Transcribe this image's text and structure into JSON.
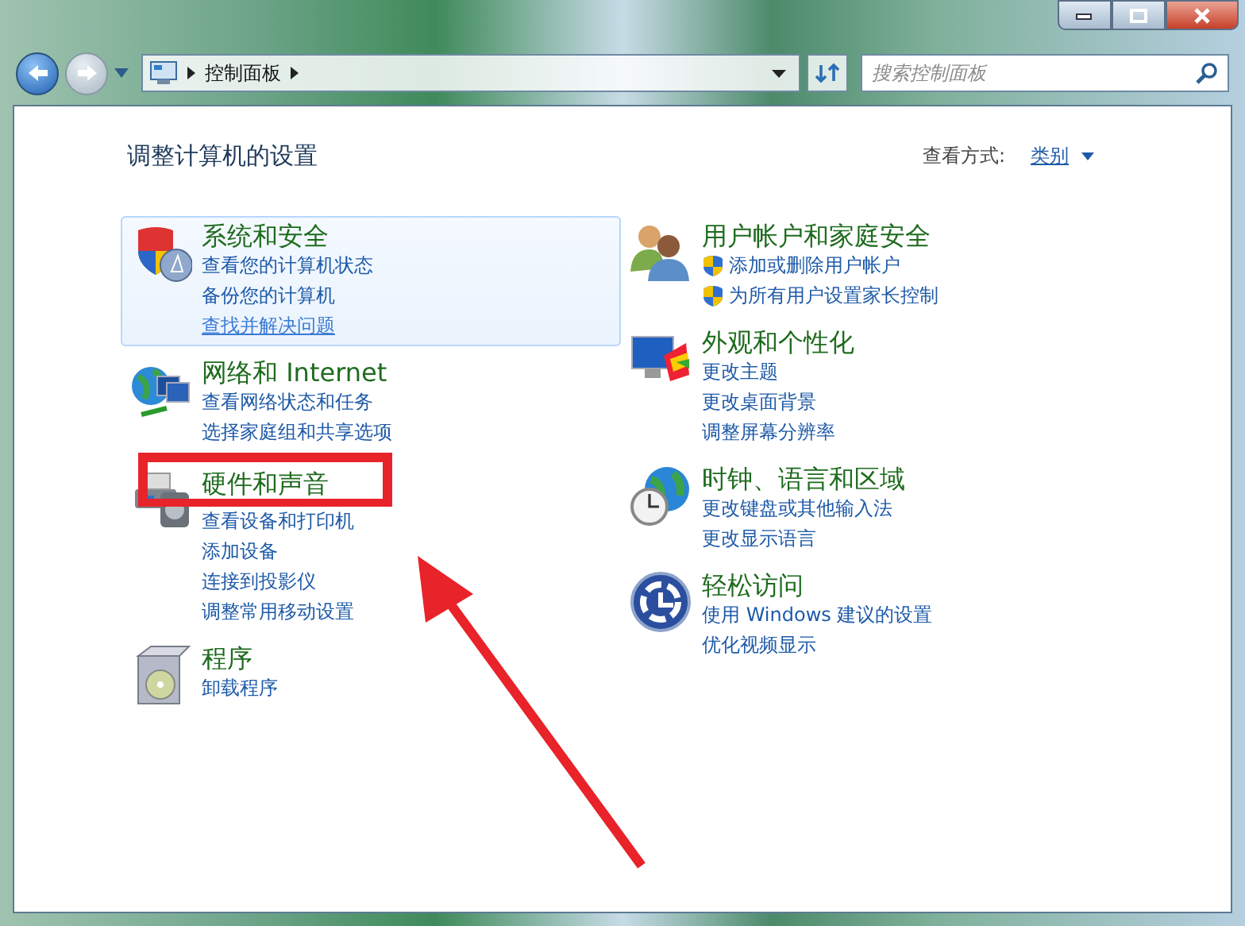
{
  "address_bar": {
    "path": [
      "控制面板"
    ],
    "search_placeholder": "搜索控制面板"
  },
  "header": {
    "title": "调整计算机的设置",
    "view_label": "查看方式:",
    "view_value": "类别"
  },
  "columns": [
    [
      {
        "title": "系统和安全",
        "selected": true,
        "links": [
          {
            "text": "查看您的计算机状态",
            "shield": false,
            "hover": false
          },
          {
            "text": "备份您的计算机",
            "shield": false,
            "hover": false
          },
          {
            "text": "查找并解决问题",
            "shield": false,
            "hover": true
          }
        ]
      },
      {
        "title": "网络和 Internet",
        "selected": false,
        "links": [
          {
            "text": "查看网络状态和任务",
            "shield": false,
            "hover": false
          },
          {
            "text": "选择家庭组和共享选项",
            "shield": false,
            "hover": false
          }
        ]
      },
      {
        "title": "硬件和声音",
        "selected": false,
        "links": [
          {
            "text": "查看设备和打印机",
            "shield": false,
            "hover": false
          },
          {
            "text": "添加设备",
            "shield": false,
            "hover": false
          },
          {
            "text": "连接到投影仪",
            "shield": false,
            "hover": false
          },
          {
            "text": "调整常用移动设置",
            "shield": false,
            "hover": false
          }
        ]
      },
      {
        "title": "程序",
        "selected": false,
        "links": [
          {
            "text": "卸载程序",
            "shield": false,
            "hover": false
          }
        ]
      }
    ],
    [
      {
        "title": "用户帐户和家庭安全",
        "selected": false,
        "links": [
          {
            "text": "添加或删除用户帐户",
            "shield": true,
            "hover": false
          },
          {
            "text": "为所有用户设置家长控制",
            "shield": true,
            "hover": false
          }
        ]
      },
      {
        "title": "外观和个性化",
        "selected": false,
        "links": [
          {
            "text": "更改主题",
            "shield": false,
            "hover": false
          },
          {
            "text": "更改桌面背景",
            "shield": false,
            "hover": false
          },
          {
            "text": "调整屏幕分辨率",
            "shield": false,
            "hover": false
          }
        ]
      },
      {
        "title": "时钟、语言和区域",
        "selected": false,
        "links": [
          {
            "text": "更改键盘或其他输入法",
            "shield": false,
            "hover": false
          },
          {
            "text": "更改显示语言",
            "shield": false,
            "hover": false
          }
        ]
      },
      {
        "title": "轻松访问",
        "selected": false,
        "links": [
          {
            "text": "使用 Windows 建议的设置",
            "shield": false,
            "hover": false
          },
          {
            "text": "优化视频显示",
            "shield": false,
            "hover": false
          }
        ]
      }
    ]
  ]
}
